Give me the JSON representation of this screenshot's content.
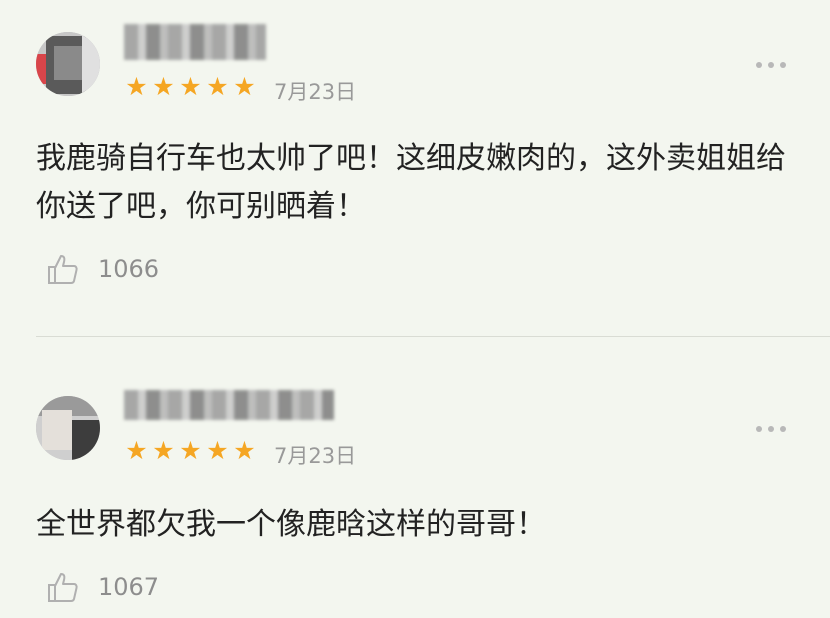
{
  "comments": [
    {
      "rating": 5,
      "date": "7月23日",
      "text": "我鹿骑自行车也太帅了吧！这细皮嫩肉的，这外卖姐姐给你送了吧，你可别晒着！",
      "likes": "1066",
      "star_icon": "star-icon",
      "like_icon": "thumbs-up-icon",
      "more_icon": "more-dots-icon"
    },
    {
      "rating": 5,
      "date": "7月23日",
      "text": "全世界都欠我一个像鹿晗这样的哥哥！",
      "likes": "1067",
      "star_icon": "star-icon",
      "like_icon": "thumbs-up-icon",
      "more_icon": "more-dots-icon"
    }
  ],
  "colors": {
    "background": "#f3f6ef",
    "star": "#f5a623",
    "meta_text": "#999999",
    "body_text": "#222222"
  }
}
